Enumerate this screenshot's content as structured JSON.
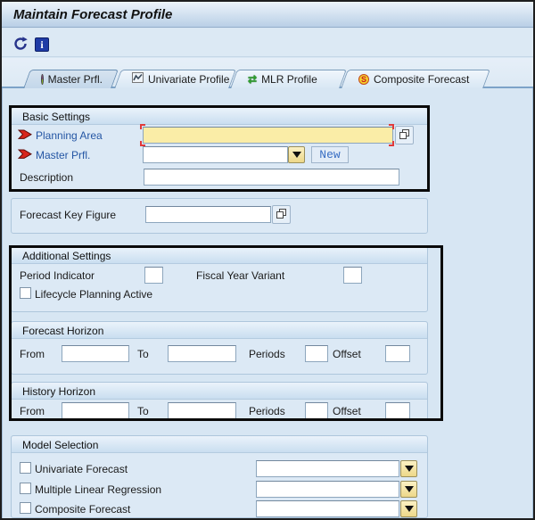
{
  "window": {
    "title": "Maintain Forecast Profile"
  },
  "toolbar": {
    "refresh_icon": "circular-arrows",
    "info_icon": "i"
  },
  "tabs": [
    {
      "label": "Master Prfl.",
      "icon": "pie-chart",
      "active": true
    },
    {
      "label": "Univariate Profile",
      "icon": "line-chart",
      "active": false
    },
    {
      "label": "MLR Profile",
      "icon": "green-swap-arrows",
      "active": false
    },
    {
      "label": "Composite Forecast",
      "icon": "sum-circle",
      "active": false
    }
  ],
  "basic_settings": {
    "title": "Basic Settings",
    "planning_area": {
      "label": "Planning Area",
      "value": "",
      "required": true
    },
    "master_prfl": {
      "label": "Master Prfl.",
      "value": "",
      "required": true
    },
    "description": {
      "label": "Description",
      "value": ""
    },
    "new_button_label": "New"
  },
  "forecast_key_figure": {
    "label": "Forecast Key Figure",
    "value": ""
  },
  "additional_settings": {
    "title": "Additional Settings",
    "period_indicator": {
      "label": "Period Indicator",
      "value": ""
    },
    "fiscal_year_variant": {
      "label": "Fiscal Year Variant",
      "value": ""
    },
    "lifecycle_planning": {
      "label": "Lifecycle Planning Active",
      "checked": false
    }
  },
  "forecast_horizon": {
    "title": "Forecast Horizon",
    "from_label": "From",
    "to_label": "To",
    "periods_label": "Periods",
    "offset_label": "Offset",
    "from_value": "",
    "to_value": "",
    "periods_value": "",
    "offset_value": ""
  },
  "history_horizon": {
    "title": "History Horizon",
    "from_label": "From",
    "to_label": "To",
    "periods_label": "Periods",
    "offset_label": "Offset",
    "from_value": "",
    "to_value": "",
    "periods_value": "",
    "offset_value": ""
  },
  "model_selection": {
    "title": "Model Selection",
    "options": [
      {
        "label": "Univariate Forecast",
        "checked": false,
        "value": ""
      },
      {
        "label": "Multiple Linear Regression",
        "checked": false,
        "value": ""
      },
      {
        "label": "Composite Forecast",
        "checked": false,
        "value": ""
      }
    ]
  },
  "icons": {
    "sum_glyph": "S",
    "swap_glyph": "⇄"
  },
  "colors": {
    "required_arrow_red": "#D8261C",
    "planning_area_field_yellow": "#FAEDA7",
    "field_label_blue": "#2456A4",
    "dropdown_button_yellow": "#EDD889",
    "annotation_border_black": "#0A0A0A"
  }
}
